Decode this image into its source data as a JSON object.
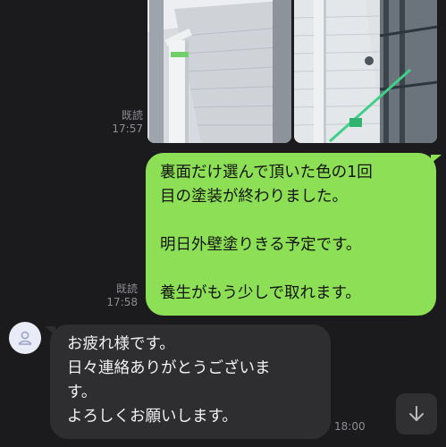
{
  "chat": {
    "sent_meta": {
      "read_label": "既読",
      "time_photos": "17:57",
      "time_text": "17:58"
    },
    "sent_message": {
      "text": "裏面だけ選んで頂いた色の1回\n目の塗装が終わりました。\n\n明日外壁塗りきる予定です。\n\n養生がもう少しで取れます。"
    },
    "received_message": {
      "text": "お疲れ様です。\n日々連絡ありがとうございま\nす。\nよろしくお願いします。",
      "time": "18:00"
    }
  },
  "icons": {
    "avatar": "person-icon",
    "scroll": "arrow-down-icon"
  },
  "colors": {
    "background": "#1b1b1d",
    "sent_bubble": "#8de055",
    "received_bubble": "#2e2e31",
    "meta_text": "#8d8d93"
  }
}
